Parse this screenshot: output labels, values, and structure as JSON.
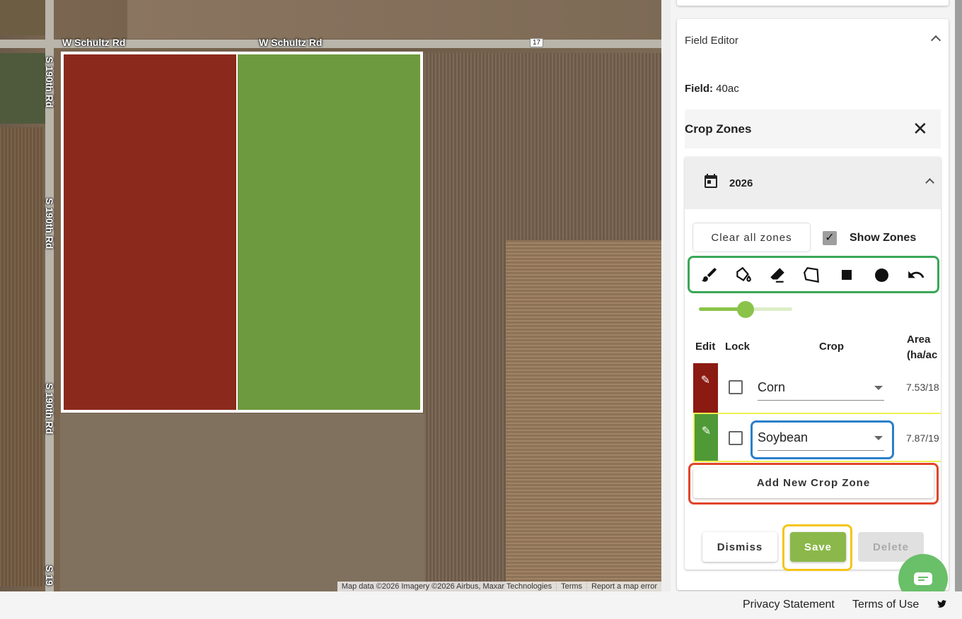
{
  "map": {
    "roads": {
      "top_left": "W Schultz Rd",
      "top_mid": "W Schultz Rd",
      "route": "17",
      "side": "S 190th Rd",
      "side2": "S 190th Rd",
      "side3": "S 190th Rd",
      "side4": "S 19"
    },
    "attribution": "Map data ©2026 Imagery ©2026 Airbus, Maxar Technologies",
    "terms": "Terms",
    "report": "Report a map error",
    "zone_colors": {
      "corn": "#8b2a1c",
      "soybean": "#6e9a3f"
    }
  },
  "panel": {
    "title": "Field Editor",
    "field_label": "Field:",
    "field_value": "40ac",
    "crop_zones_title": "Crop Zones",
    "year": "2026",
    "clear_all": "Clear all zones",
    "show_zones": "Show Zones",
    "show_zones_checked": true,
    "brush_size_percent": 50,
    "tools": [
      "brush-icon",
      "fill-icon",
      "eraser-icon",
      "polygon-icon",
      "square-icon",
      "circle-icon",
      "undo-icon"
    ],
    "table": {
      "headers": {
        "edit": "Edit",
        "lock": "Lock",
        "crop": "Crop",
        "area": "Area",
        "area_unit": "(ha/ac"
      },
      "rows": [
        {
          "crop": "Corn",
          "area": "7.53/18",
          "color": "#8b1a12",
          "locked": false
        },
        {
          "crop": "Soybean",
          "area": "7.87/19",
          "color": "#4f9a36",
          "locked": false
        }
      ]
    },
    "add_zone": "Add New Crop Zone",
    "dismiss": "Dismiss",
    "save": "Save",
    "delete": "Delete"
  },
  "footer": {
    "privacy": "Privacy Statement",
    "terms": "Terms of Use"
  }
}
